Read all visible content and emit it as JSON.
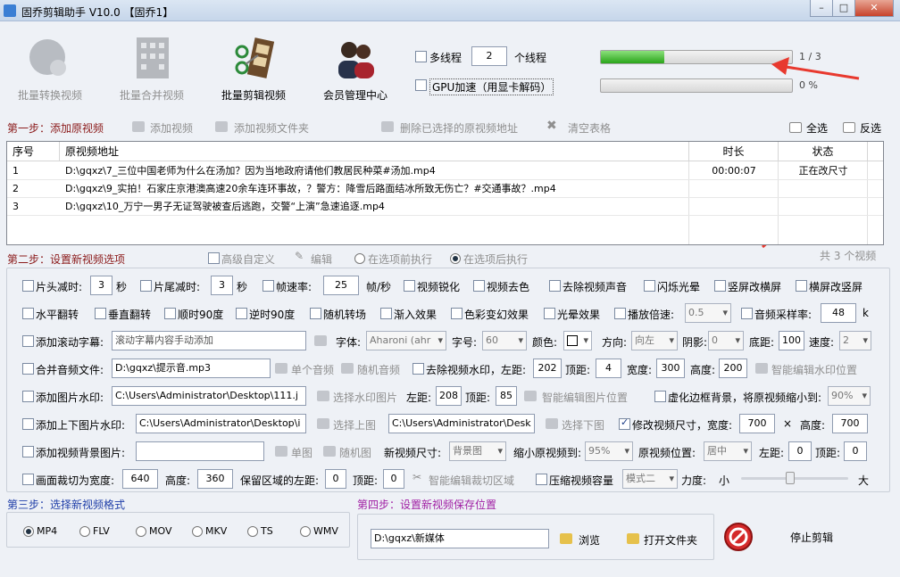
{
  "window": {
    "title": "固乔剪辑助手 V10.0 【固乔1】",
    "min": "–",
    "max": "□",
    "close": "✕"
  },
  "toolbar": {
    "batch_convert": "批量转换视频",
    "batch_merge": "批量合并视频",
    "batch_edit": "批量剪辑视频",
    "member_center": "会员管理中心",
    "multithread_label": "多线程",
    "thread_count": "2",
    "thread_unit": "个线程",
    "gpu_label": "GPU加速（用显卡解码）",
    "progress1_text": "1 / 3",
    "progress1_fraction": 0.33,
    "progress2_text": "0 %",
    "progress2_fraction": 0
  },
  "step1": {
    "title": "第一步：添加原视频",
    "add_video": "添加视频",
    "add_folder": "添加视频文件夹",
    "delete_selected": "删除已选择的原视频地址",
    "clear_table": "清空表格",
    "select_all": "全选",
    "invert": "反选"
  },
  "table": {
    "headers": {
      "no": "序号",
      "path": "原视频地址",
      "duration": "时长",
      "status": "状态"
    },
    "rows": [
      {
        "no": "1",
        "path": "D:\\gqxz\\7_三位中国老师为什么在汤加？因为当地政府请他们教居民种菜#汤加.mp4",
        "duration": "00:00:07",
        "status": "正在改尺寸"
      },
      {
        "no": "2",
        "path": "D:\\gqxz\\9_实拍！石家庄京港澳高速20余车连环事故，？警方：降雪后路面结冰所致无伤亡？#交通事故？.mp4",
        "duration": "",
        "status": ""
      },
      {
        "no": "3",
        "path": "D:\\gqxz\\10_万宁一男子无证驾驶被查后逃跑，交警“上演”急速追逐.mp4",
        "duration": "",
        "status": ""
      }
    ]
  },
  "step2": {
    "title": "第二步：设置新视频选项",
    "advanced": "高级自定义",
    "edit": "编辑",
    "before": "在选项前执行",
    "after": "在选项后执行",
    "count": "共 3 个视频"
  },
  "opts": {
    "head_cut": "片头减时:",
    "head_val": "3",
    "sec1": "秒",
    "tail_cut": "片尾减时:",
    "tail_val": "3",
    "sec2": "秒",
    "fps": "帧速率:",
    "fps_val": "25",
    "fps_unit": "帧/秒",
    "sharpen": "视频锐化",
    "decolor": "视频去色",
    "mute": "去除视频声音",
    "flash": "闪烁光晕",
    "v2h": "竖屏改横屏",
    "h2v": "横屏改竖屏",
    "hflip": "水平翻转",
    "vflip": "垂直翻转",
    "rot90cw": "顺时90度",
    "rot90ccw": "逆时90度",
    "rand_trans": "随机转场",
    "fadein": "渐入效果",
    "color_fx": "色彩变幻效果",
    "light_fx": "光晕效果",
    "speed": "播放倍速:",
    "speed_val": "0.5",
    "sample": "音频采样率:",
    "sample_val": "48",
    "sample_unit": "k",
    "scroll": "添加滚动字幕:",
    "scroll_text": "滚动字幕内容手动添加",
    "font": "字体:",
    "font_val": "Aharoni (ahr",
    "size": "字号:",
    "size_val": "60",
    "color": "颜色:",
    "dir": "方向:",
    "dir_val": "向左",
    "shadow": "阴影:",
    "shadow_val": "0",
    "bottom": "底距:",
    "bottom_val": "100",
    "spd": "速度:",
    "spd_val": "2",
    "merge_audio": "合并音频文件:",
    "audio_path": "D:\\gqxz\\提示音.mp3",
    "single_audio": "单个音频",
    "rand_audio": "随机音频",
    "rm_wm": "去除视频水印，左距:",
    "wm_left": "202",
    "wm_top_l": "顶距:",
    "wm_top": "4",
    "wm_w_l": "宽度:",
    "wm_w": "300",
    "wm_h_l": "高度:",
    "wm_h": "200",
    "smart_wm": "智能编辑水印位置",
    "img_wm": "添加图片水印:",
    "img_path": "C:\\Users\\Administrator\\Desktop\\111.j",
    "sel_wm_img": "选择水印图片",
    "img_left_l": "左距:",
    "img_left": "208",
    "img_top_l": "顶距:",
    "img_top": "85",
    "smart_img": "智能编辑图片位置",
    "blur_bg": "虚化边框背景，将原视频缩小到:",
    "blur_val": "90%",
    "tb_wm": "添加上下图片水印:",
    "top_path": "C:\\Users\\Administrator\\Desktop\\i",
    "sel_top": "选择上图",
    "bot_path": "C:\\Users\\Administrator\\Desk",
    "sel_bot": "选择下图",
    "resize": "修改视频尺寸，宽度:",
    "resize_w": "700",
    "times": "×",
    "height_l": "高度:",
    "resize_h": "700",
    "bg_img": "添加视频背景图片:",
    "single_img": "单图",
    "rand_img": "随机图",
    "new_size": "新视频尺寸:",
    "new_size_val": "背景图",
    "shrink": "缩小原视频到:",
    "shrink_val": "95%",
    "orig_pos": "原视频位置:",
    "orig_pos_val": "居中",
    "left_l": "左距:",
    "left_v": "0",
    "top_l": "顶距:",
    "top_v": "0",
    "crop": "画面裁切为宽度:",
    "crop_w": "640",
    "crop_h_l": "高度:",
    "crop_h": "360",
    "keep_left": "保留区域的左距:",
    "keep_left_v": "0",
    "keep_top_l": "顶距:",
    "keep_top": "0",
    "smart_crop": "智能编辑裁切区域",
    "compress": "压缩视频容量",
    "mode": "模式二",
    "force": "力度:",
    "small": "小",
    "large": "大"
  },
  "step3": {
    "title": "第三步：选择新视频格式",
    "formats": [
      "MP4",
      "FLV",
      "MOV",
      "MKV",
      "TS",
      "WMV"
    ],
    "selected": "MP4"
  },
  "step4": {
    "title": "第四步：设置新视频保存位置",
    "path": "D:\\gqxz\\新媒体",
    "browse": "浏览",
    "open_folder": "打开文件夹",
    "stop": "停止剪辑"
  },
  "colors": {
    "progress": "#2aa51a",
    "arrow": "#e8392e"
  }
}
